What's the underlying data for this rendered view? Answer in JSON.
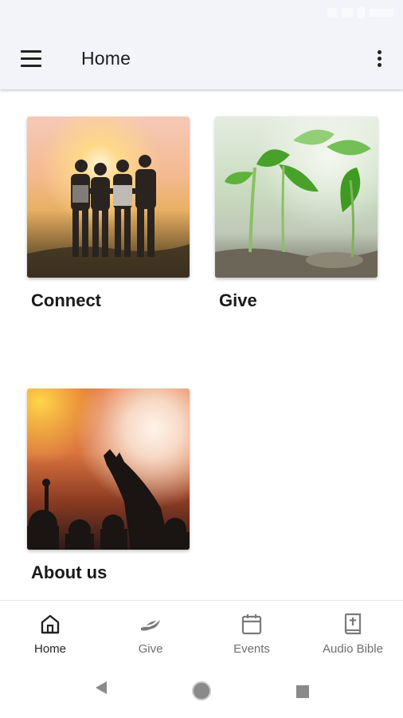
{
  "app_bar": {
    "title": "Home",
    "menu_icon": "hamburger-menu-icon",
    "overflow_icon": "more-vert-icon"
  },
  "cards": [
    {
      "label": "Connect",
      "image": "friends-sunset-photo"
    },
    {
      "label": "Give",
      "image": "seedlings-photo"
    },
    {
      "label": "About us",
      "image": "worship-concert-photo"
    }
  ],
  "bottom_nav": {
    "items": [
      {
        "label": "Home",
        "icon": "home-icon",
        "active": true
      },
      {
        "label": "Give",
        "icon": "giving-hand-icon",
        "active": false
      },
      {
        "label": "Events",
        "icon": "calendar-icon",
        "active": false
      },
      {
        "label": "Audio Bible",
        "icon": "bible-book-icon",
        "active": false
      }
    ]
  },
  "system_nav": {
    "back": "back-triangle-icon",
    "home": "home-circle-icon",
    "recents": "recents-square-icon"
  },
  "colors": {
    "app_bar_bg": "#f3f4f9",
    "active_nav": "#232323",
    "inactive_nav": "#6f6f6f"
  }
}
